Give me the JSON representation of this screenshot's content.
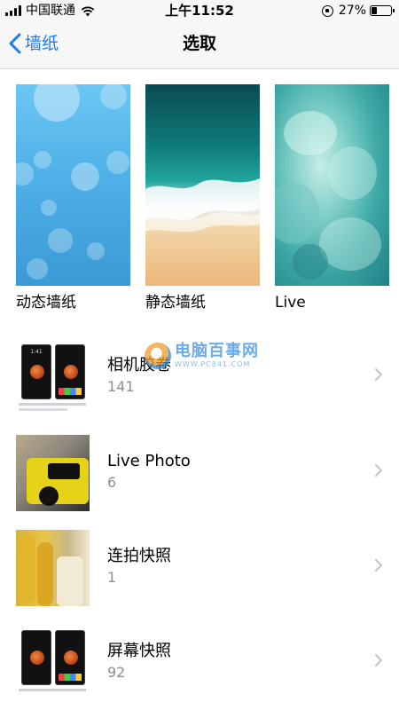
{
  "status_bar": {
    "carrier": "中国联通",
    "time": "上午11:52",
    "battery_percent": "27%",
    "battery_level": 0.27
  },
  "nav": {
    "back_label": "墙纸",
    "title": "选取"
  },
  "wallpaper_categories": [
    {
      "label": "动态墙纸"
    },
    {
      "label": "静态墙纸"
    },
    {
      "label": "Live"
    }
  ],
  "albums": [
    {
      "name": "相机胶卷",
      "count": "141"
    },
    {
      "name": "Live Photo",
      "count": "6"
    },
    {
      "name": "连拍快照",
      "count": "1"
    },
    {
      "name": "屏幕快照",
      "count": "92"
    }
  ],
  "thumb_phone_time": "1:41",
  "watermark": {
    "title": "电脑百事网",
    "subtitle": "WWW.PC841.COM"
  },
  "colors": {
    "accent": "#1a7cf5",
    "secondary_text": "#8e8e93",
    "bar_background": "#f7f7f7"
  }
}
